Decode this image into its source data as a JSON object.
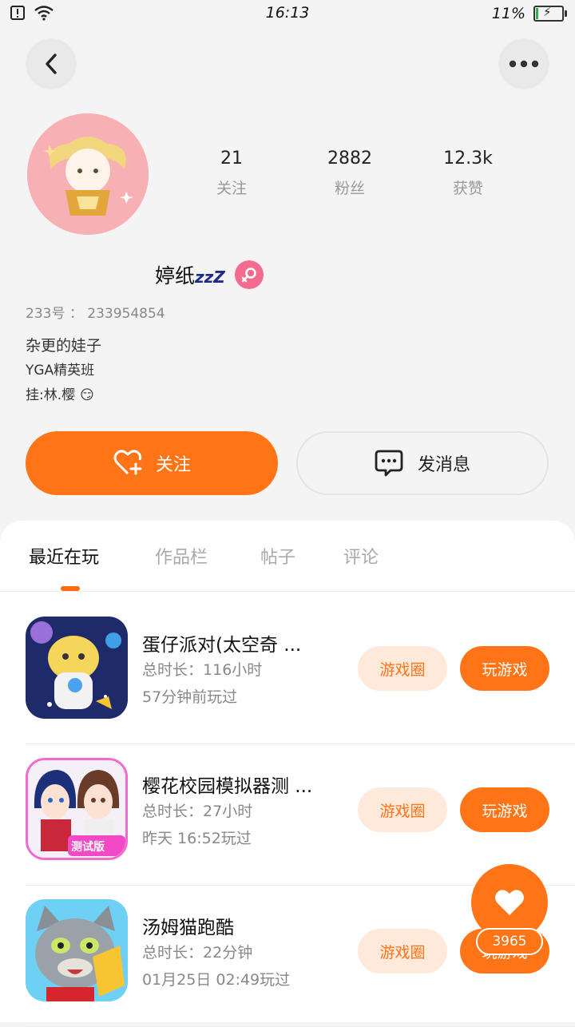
{
  "status_bar": {
    "time": "16:13",
    "battery_percent": "11%",
    "battery_level": 0.11,
    "icons": [
      "sim-alert-icon",
      "wifi-icon",
      "battery-charging-icon"
    ]
  },
  "header": {
    "back_icon": "back-arrow-icon",
    "more_icon": "more-dots-icon"
  },
  "profile": {
    "avatar": "avatar-icon",
    "name": "婷纸",
    "name_suffix": "zzZ",
    "gender_icon": "female-icon",
    "uid_label": "233号",
    "uid_sep": "：",
    "uid_value": "233954854",
    "bio_lines": [
      "杂更的娃子",
      "YGA精英班",
      "挂:林.樱"
    ],
    "bio_emoji": "😏",
    "stats": [
      {
        "value": "21",
        "label": "关注"
      },
      {
        "value": "2882",
        "label": "粉丝"
      },
      {
        "value": "12.3k",
        "label": "获赞"
      }
    ]
  },
  "actions": {
    "follow_label": "关注",
    "message_label": "发消息"
  },
  "tabs": [
    {
      "label": "最近在玩",
      "active": true
    },
    {
      "label": "作品栏",
      "active": false
    },
    {
      "label": "帖子",
      "active": false
    },
    {
      "label": "评论",
      "active": false
    }
  ],
  "games": [
    {
      "title": "蛋仔派对(太空奇 ...",
      "duration_label": "总时长",
      "sep": "：",
      "duration_value": "116小时",
      "last_played": "57分钟前玩过",
      "circle_label": "游戏圈",
      "play_label": "玩游戏"
    },
    {
      "title": "樱花校园模拟器测 ...",
      "duration_label": "总时长",
      "sep": "：",
      "duration_value": "27小时",
      "last_played": "昨天 16:52玩过",
      "badge": "测试版",
      "circle_label": "游戏圈",
      "play_label": "玩游戏"
    },
    {
      "title": "汤姆猫跑酷",
      "duration_label": "总时长",
      "sep": "：",
      "duration_value": "22分钟",
      "last_played": "01月25日 02:49玩过",
      "circle_label": "游戏圈",
      "play_label": "玩游戏"
    }
  ],
  "fab": {
    "icon": "heart-icon",
    "count": "3965"
  },
  "colors": {
    "accent": "#ff7417",
    "accent_light": "#ffe9db",
    "background": "#f4f4f4"
  }
}
